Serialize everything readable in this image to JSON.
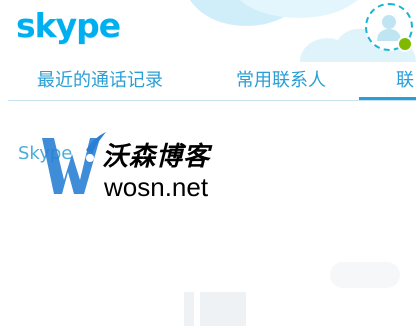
{
  "header": {
    "logo_text": "skype",
    "accent_color": "#00aff0"
  },
  "profile": {
    "avatar_icon": "user-silhouette-icon",
    "presence_status": "online",
    "presence_color": "#7fba00"
  },
  "tabs": [
    {
      "label": "最近的通话记录",
      "active": false
    },
    {
      "label": "常用联系人",
      "active": false
    },
    {
      "label": "联",
      "active": true
    }
  ],
  "content": {
    "skype_label": "Skype"
  },
  "watermark": {
    "logo_icon": "w-logo-icon",
    "title": "沃森博客",
    "url": "wosn.net"
  }
}
